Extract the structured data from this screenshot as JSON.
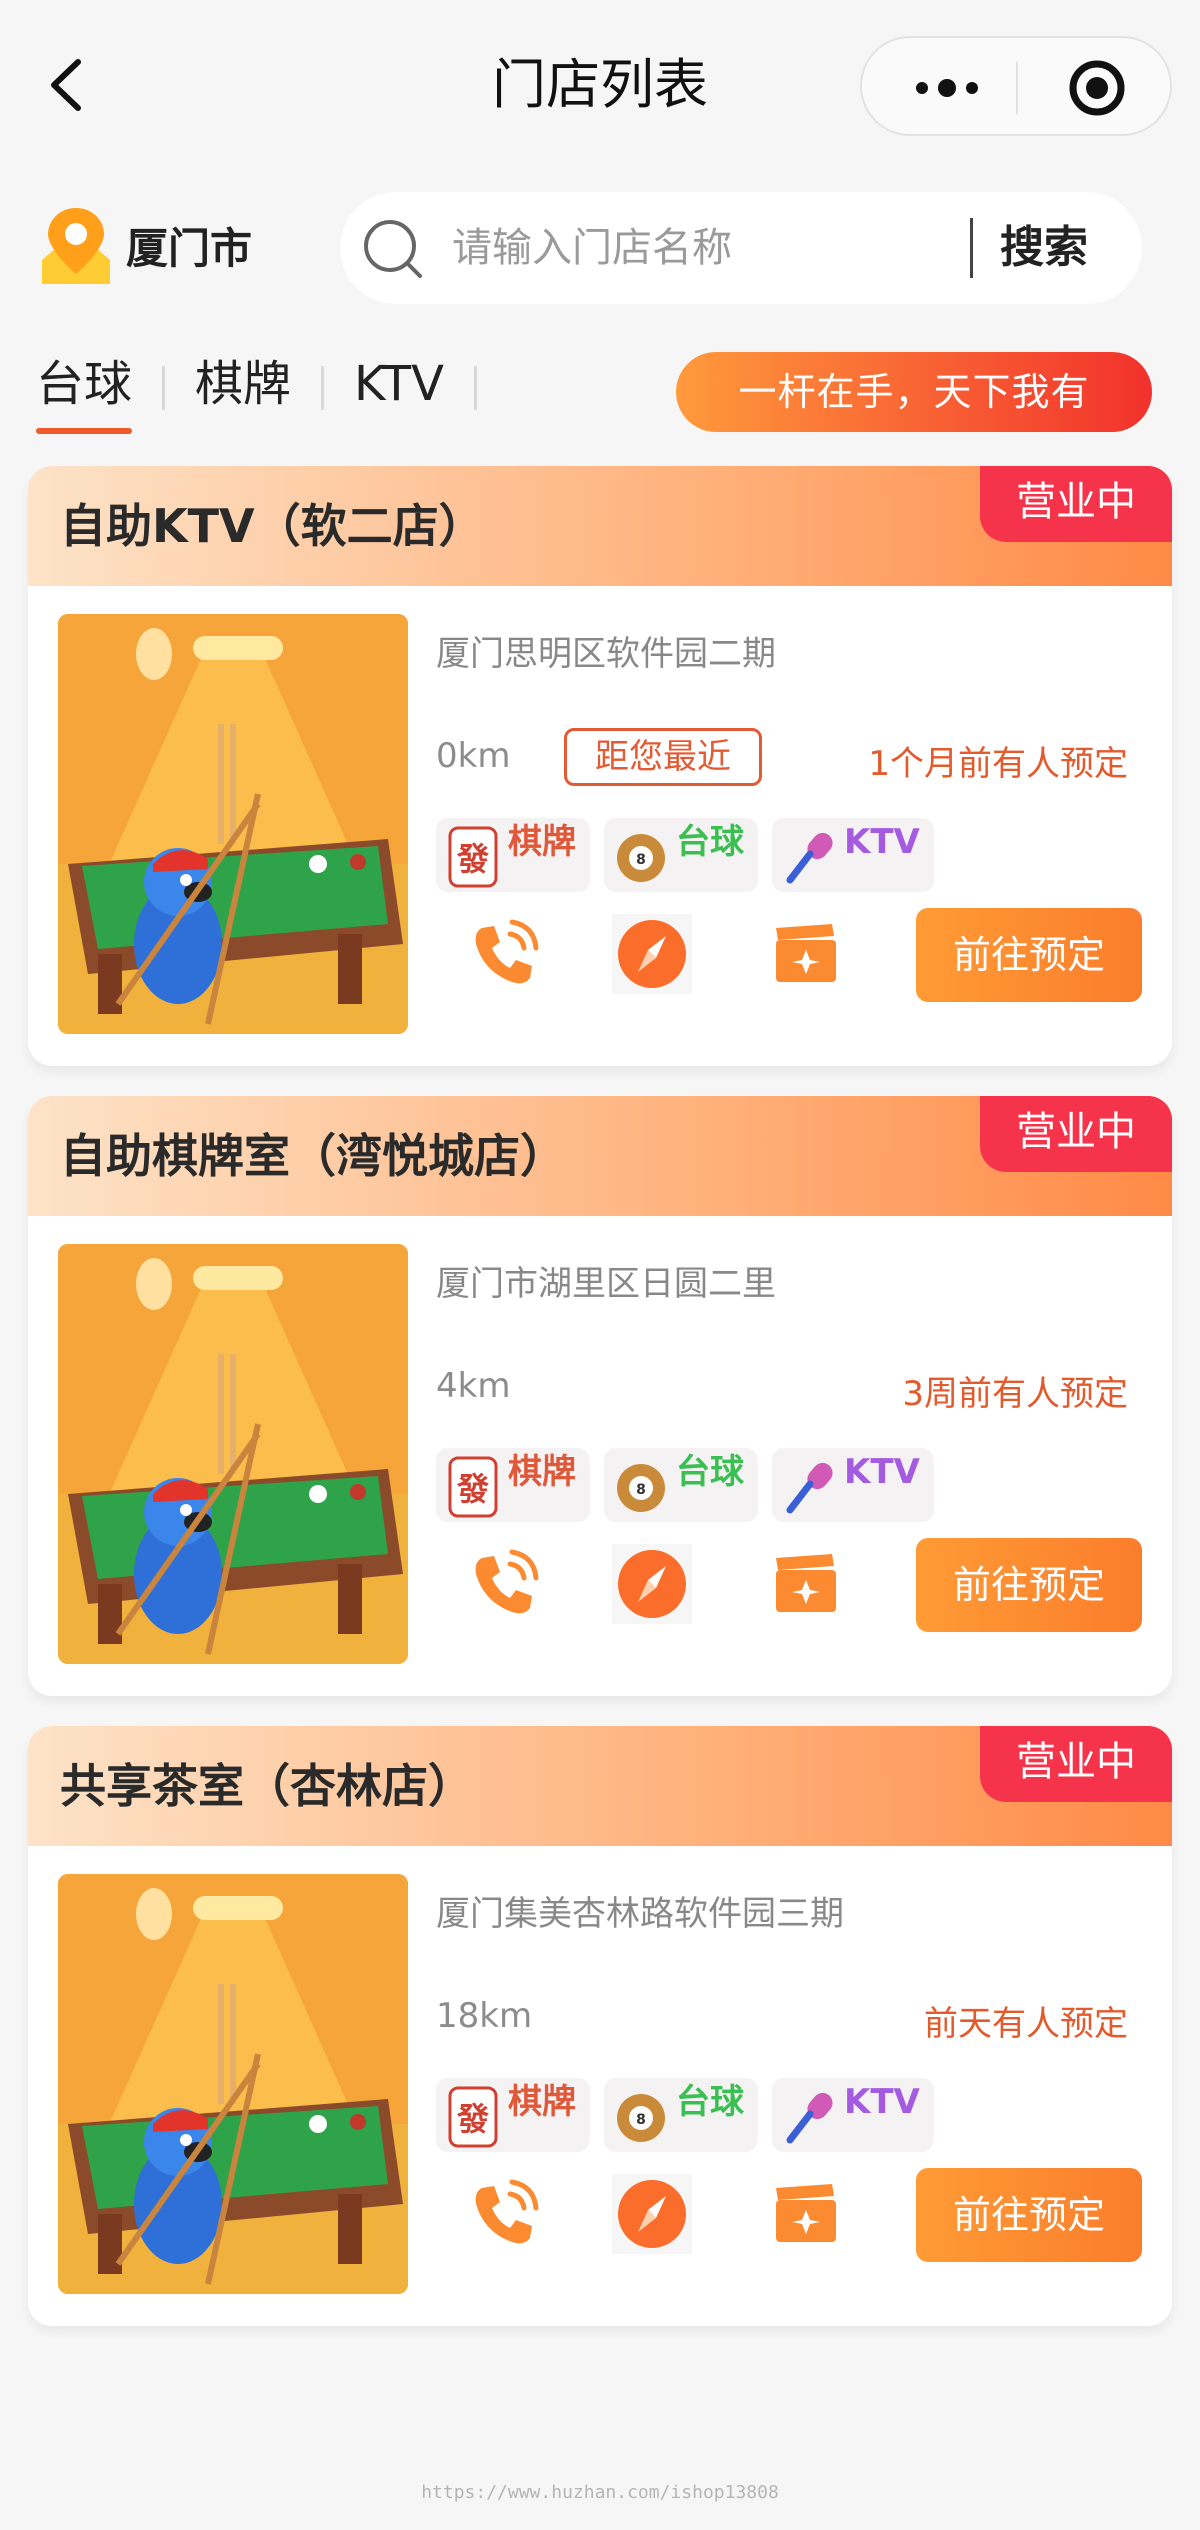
{
  "nav": {
    "title": "门店列表"
  },
  "location": {
    "city": "厦门市"
  },
  "search": {
    "placeholder": "请输入门店名称",
    "button": "搜索"
  },
  "tabs": [
    {
      "label": "台球",
      "active": true
    },
    {
      "label": "棋牌",
      "active": false
    },
    {
      "label": "KTV",
      "active": false
    }
  ],
  "slogan": "一杆在手，天下我有",
  "colors": {
    "accent": "#f05a2a",
    "badge": "#f5334a",
    "book_button": "#fb8a30",
    "tag_qipai": "#e0583a",
    "tag_taiqiu": "#3bbf52",
    "tag_ktv": "#a55be0"
  },
  "stores": [
    {
      "name": "自助KTV（软二店）",
      "status": "营业中",
      "address": "厦门思明区软件园二期",
      "distance": "0km",
      "nearest_label": "距您最近",
      "booked": "1个月前有人预定",
      "tags": [
        "棋牌",
        "台球",
        "KTV"
      ],
      "book_label": "前往预定"
    },
    {
      "name": "自助棋牌室（湾悦城店）",
      "status": "营业中",
      "address": "厦门市湖里区日圆二里",
      "distance": "4km",
      "nearest_label": "",
      "booked": "3周前有人预定",
      "tags": [
        "棋牌",
        "台球",
        "KTV"
      ],
      "book_label": "前往预定"
    },
    {
      "name": "共享茶室（杏林店）",
      "status": "营业中",
      "address": "厦门集美杏林路软件园三期",
      "distance": "18km",
      "nearest_label": "",
      "booked": "前天有人预定",
      "tags": [
        "棋牌",
        "台球",
        "KTV"
      ],
      "book_label": "前往预定"
    }
  ],
  "icons": {
    "back": "chevron-left-icon",
    "more": "more-dots-icon",
    "close": "target-icon",
    "location": "location-pin-icon",
    "search": "search-icon",
    "phone": "phone-icon",
    "navigate": "compass-icon",
    "video": "video-clapper-icon",
    "tag_qipai": "mahjong-tile-icon",
    "tag_taiqiu": "billiard-ball-icon",
    "tag_ktv": "microphone-icon"
  },
  "watermark": "https://www.huzhan.com/ishop13808"
}
